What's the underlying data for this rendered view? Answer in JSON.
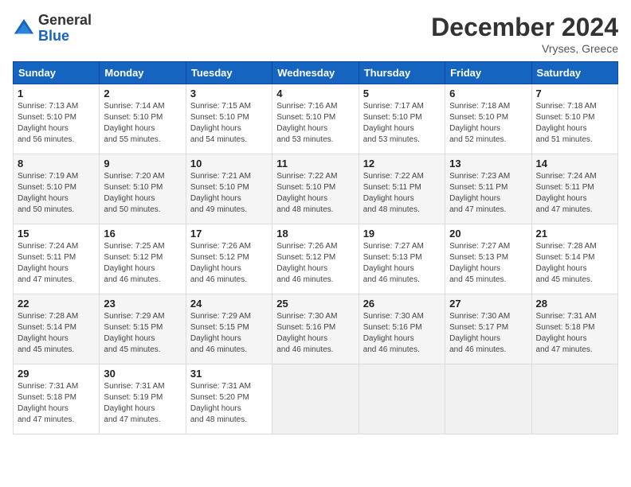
{
  "header": {
    "logo_general": "General",
    "logo_blue": "Blue",
    "month": "December 2024",
    "location": "Vryses, Greece"
  },
  "days_of_week": [
    "Sunday",
    "Monday",
    "Tuesday",
    "Wednesday",
    "Thursday",
    "Friday",
    "Saturday"
  ],
  "weeks": [
    [
      {
        "day": "1",
        "sunrise": "7:13 AM",
        "sunset": "5:10 PM",
        "daylight": "9 hours and 56 minutes."
      },
      {
        "day": "2",
        "sunrise": "7:14 AM",
        "sunset": "5:10 PM",
        "daylight": "9 hours and 55 minutes."
      },
      {
        "day": "3",
        "sunrise": "7:15 AM",
        "sunset": "5:10 PM",
        "daylight": "9 hours and 54 minutes."
      },
      {
        "day": "4",
        "sunrise": "7:16 AM",
        "sunset": "5:10 PM",
        "daylight": "9 hours and 53 minutes."
      },
      {
        "day": "5",
        "sunrise": "7:17 AM",
        "sunset": "5:10 PM",
        "daylight": "9 hours and 53 minutes."
      },
      {
        "day": "6",
        "sunrise": "7:18 AM",
        "sunset": "5:10 PM",
        "daylight": "9 hours and 52 minutes."
      },
      {
        "day": "7",
        "sunrise": "7:18 AM",
        "sunset": "5:10 PM",
        "daylight": "9 hours and 51 minutes."
      }
    ],
    [
      {
        "day": "8",
        "sunrise": "7:19 AM",
        "sunset": "5:10 PM",
        "daylight": "9 hours and 50 minutes."
      },
      {
        "day": "9",
        "sunrise": "7:20 AM",
        "sunset": "5:10 PM",
        "daylight": "9 hours and 50 minutes."
      },
      {
        "day": "10",
        "sunrise": "7:21 AM",
        "sunset": "5:10 PM",
        "daylight": "9 hours and 49 minutes."
      },
      {
        "day": "11",
        "sunrise": "7:22 AM",
        "sunset": "5:10 PM",
        "daylight": "9 hours and 48 minutes."
      },
      {
        "day": "12",
        "sunrise": "7:22 AM",
        "sunset": "5:11 PM",
        "daylight": "9 hours and 48 minutes."
      },
      {
        "day": "13",
        "sunrise": "7:23 AM",
        "sunset": "5:11 PM",
        "daylight": "9 hours and 47 minutes."
      },
      {
        "day": "14",
        "sunrise": "7:24 AM",
        "sunset": "5:11 PM",
        "daylight": "9 hours and 47 minutes."
      }
    ],
    [
      {
        "day": "15",
        "sunrise": "7:24 AM",
        "sunset": "5:11 PM",
        "daylight": "9 hours and 47 minutes."
      },
      {
        "day": "16",
        "sunrise": "7:25 AM",
        "sunset": "5:12 PM",
        "daylight": "9 hours and 46 minutes."
      },
      {
        "day": "17",
        "sunrise": "7:26 AM",
        "sunset": "5:12 PM",
        "daylight": "9 hours and 46 minutes."
      },
      {
        "day": "18",
        "sunrise": "7:26 AM",
        "sunset": "5:12 PM",
        "daylight": "9 hours and 46 minutes."
      },
      {
        "day": "19",
        "sunrise": "7:27 AM",
        "sunset": "5:13 PM",
        "daylight": "9 hours and 46 minutes."
      },
      {
        "day": "20",
        "sunrise": "7:27 AM",
        "sunset": "5:13 PM",
        "daylight": "9 hours and 45 minutes."
      },
      {
        "day": "21",
        "sunrise": "7:28 AM",
        "sunset": "5:14 PM",
        "daylight": "9 hours and 45 minutes."
      }
    ],
    [
      {
        "day": "22",
        "sunrise": "7:28 AM",
        "sunset": "5:14 PM",
        "daylight": "9 hours and 45 minutes."
      },
      {
        "day": "23",
        "sunrise": "7:29 AM",
        "sunset": "5:15 PM",
        "daylight": "9 hours and 45 minutes."
      },
      {
        "day": "24",
        "sunrise": "7:29 AM",
        "sunset": "5:15 PM",
        "daylight": "9 hours and 46 minutes."
      },
      {
        "day": "25",
        "sunrise": "7:30 AM",
        "sunset": "5:16 PM",
        "daylight": "9 hours and 46 minutes."
      },
      {
        "day": "26",
        "sunrise": "7:30 AM",
        "sunset": "5:16 PM",
        "daylight": "9 hours and 46 minutes."
      },
      {
        "day": "27",
        "sunrise": "7:30 AM",
        "sunset": "5:17 PM",
        "daylight": "9 hours and 46 minutes."
      },
      {
        "day": "28",
        "sunrise": "7:31 AM",
        "sunset": "5:18 PM",
        "daylight": "9 hours and 47 minutes."
      }
    ],
    [
      {
        "day": "29",
        "sunrise": "7:31 AM",
        "sunset": "5:18 PM",
        "daylight": "9 hours and 47 minutes."
      },
      {
        "day": "30",
        "sunrise": "7:31 AM",
        "sunset": "5:19 PM",
        "daylight": "9 hours and 47 minutes."
      },
      {
        "day": "31",
        "sunrise": "7:31 AM",
        "sunset": "5:20 PM",
        "daylight": "9 hours and 48 minutes."
      },
      null,
      null,
      null,
      null
    ]
  ]
}
